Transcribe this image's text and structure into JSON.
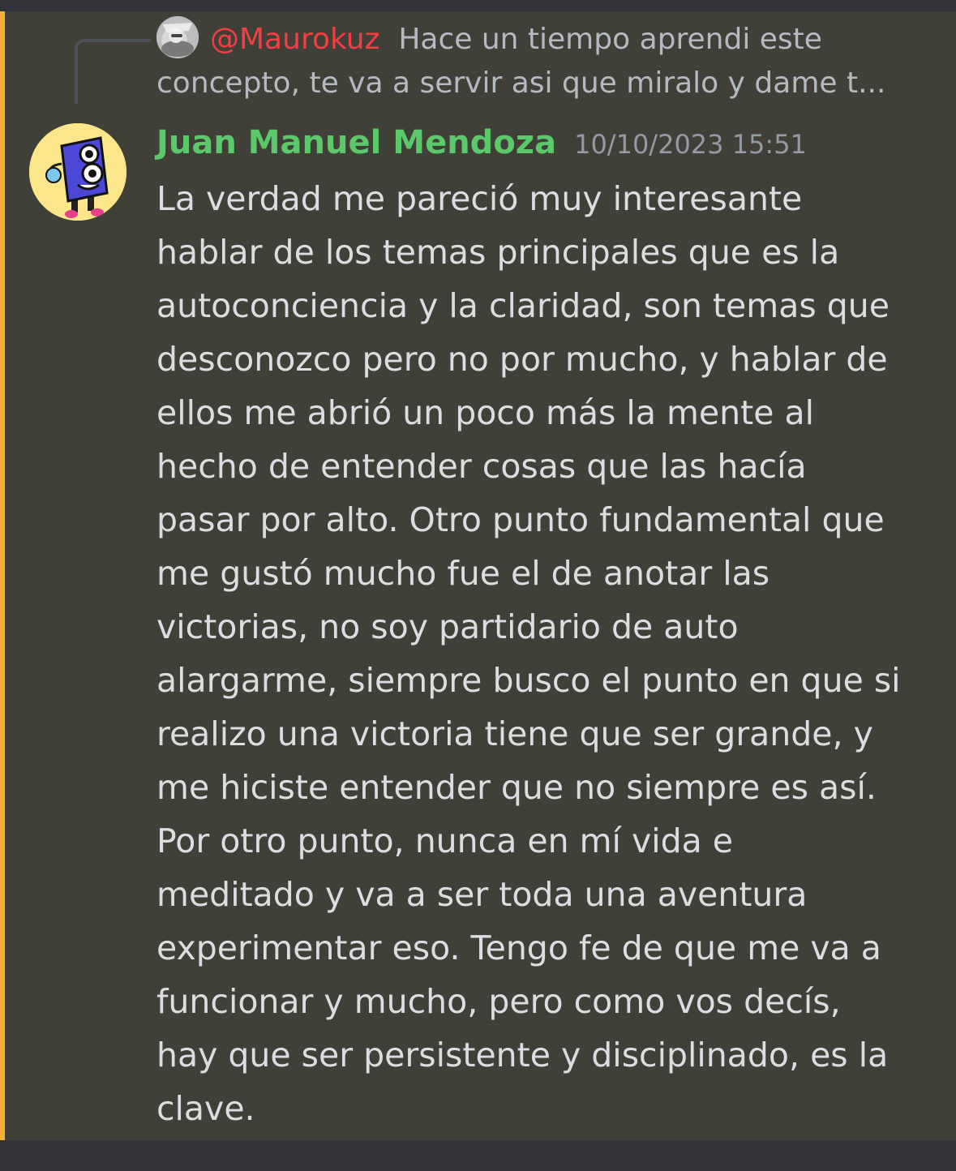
{
  "reply": {
    "author": "@Maurokuz",
    "preview": "Hace un tiempo aprendi este concepto, te va a servir asi que miralo y dame t..."
  },
  "message": {
    "author": "Juan Manuel Mendoza",
    "timestamp": "10/10/2023 15:51",
    "content": "La verdad me pareció muy interesante\nhablar de los temas principales que es la\nautoconciencia y la claridad, son temas que\ndesconozco pero no por mucho, y hablar de\nellos me abrió un poco más la mente al\nhecho de entender cosas que las hacía\npasar por alto. Otro punto fundamental que\nme gustó mucho fue el de anotar las\nvictorias, no soy partidario de auto\nalargarme, siempre busco el punto en que si\nrealizo una victoria tiene que ser grande, y\nme hiciste entender que no siempre es así.\nPor otro punto, nunca en mí vida e\nmeditado y va a ser toda una aventura\nexperimentar eso. Tengo fe de que me va a\nfuncionar y mucho, pero como vos decís,\nhay que ser persistente y disciplinado, es la\nclave."
  },
  "colors": {
    "background": "#313338",
    "highlight_background": "#403f38",
    "mention_bar": "#f0b232",
    "author": "#5bc86c",
    "reply_author": "#f23f43",
    "text": "#dbdee1",
    "muted": "#b5bac1",
    "timestamp": "#949ba4"
  },
  "icons": {
    "reply_avatar": "user-avatar-photo",
    "avatar": "blue-robot-avatar"
  }
}
